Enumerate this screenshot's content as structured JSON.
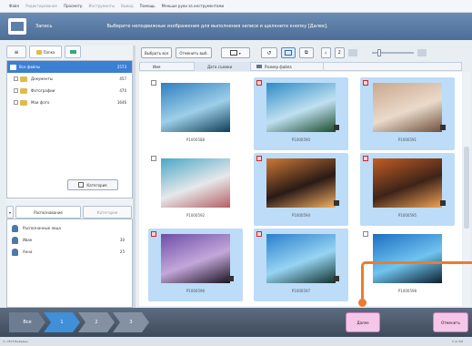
{
  "menu": [
    {
      "label": "Файл",
      "dim": false
    },
    {
      "label": "Редактирование",
      "dim": true
    },
    {
      "label": "Просмотр",
      "dim": false
    },
    {
      "label": "Инструменты",
      "dim": true
    },
    {
      "label": "Вывод",
      "dim": true
    },
    {
      "label": "Помощь",
      "dim": false
    },
    {
      "label": "Меньше руки за инструментами",
      "dim": false
    }
  ],
  "header": {
    "title": "Запись",
    "instruction": "Выберите неподвижные изображения для выполнения записи и щелкните кнопку [Далее]."
  },
  "left_tabs": [
    "Папка"
  ],
  "tree": [
    {
      "label": "Все файлы",
      "count": "2573",
      "expand": false,
      "selected": true
    },
    {
      "label": "Документы",
      "count": "457",
      "expand": true,
      "selected": false
    },
    {
      "label": "Фотографии",
      "count": "470",
      "expand": true,
      "selected": false
    },
    {
      "label": "Мои фото",
      "count": "1646",
      "expand": true,
      "selected": false
    }
  ],
  "lower_tabs": [
    "Распознавание",
    "Категория"
  ],
  "people_list": [
    {
      "label": "Распознанные лица",
      "count": ""
    },
    {
      "label": "Иван",
      "count": "30"
    },
    {
      "label": "Анна",
      "count": "25"
    }
  ],
  "category_button": "Категория",
  "toolbar": {
    "select_all": "Выбрать все",
    "deselect": "Отменить выб."
  },
  "sort_columns": [
    "Имя",
    "Дата съемки",
    "Размер файла"
  ],
  "thumbnails": [
    {
      "name": "P1000588",
      "selected": false,
      "flag": false,
      "palette": [
        "#2f7fbf",
        "#9ecfe8",
        "#0e3d58"
      ]
    },
    {
      "name": "P1000590",
      "selected": true,
      "flag": true,
      "palette": [
        "#2e8bc6",
        "#bfe0f0",
        "#1b4c2b"
      ]
    },
    {
      "name": "P1000591",
      "selected": true,
      "flag": true,
      "palette": [
        "#c9a88c",
        "#eadacb",
        "#6d4f3a"
      ]
    },
    {
      "name": "P1000592",
      "selected": false,
      "flag": false,
      "palette": [
        "#4aa7c6",
        "#e6e8ea",
        "#b45f65"
      ]
    },
    {
      "name": "P1000594",
      "selected": true,
      "flag": true,
      "palette": [
        "#cc7a35",
        "#2a1a16",
        "#f3b066"
      ]
    },
    {
      "name": "P1000595",
      "selected": true,
      "flag": true,
      "palette": [
        "#c35d23",
        "#3d2418",
        "#f1a258"
      ]
    },
    {
      "name": "P1000596",
      "selected": true,
      "flag": true,
      "palette": [
        "#6e4ea7",
        "#c3a7da",
        "#1a1320"
      ]
    },
    {
      "name": "P1000597",
      "selected": true,
      "flag": true,
      "palette": [
        "#297fcc",
        "#97d4f2",
        "#10312c"
      ]
    },
    {
      "name": "P1000598",
      "selected": false,
      "flag": false,
      "palette": [
        "#1d6fc2",
        "#6fc4ef",
        "#0b1f2c"
      ]
    }
  ],
  "steps": [
    "Все",
    "1",
    "2",
    "3"
  ],
  "buttons": {
    "next": "Далее",
    "cancel": "Отменить"
  },
  "status": {
    "left": "3 / 2573 Выбраны",
    "right": "3 из 3/8"
  },
  "colors": {
    "accent": "#ec7b30",
    "selection": "#3d7fd1",
    "thumb_sel": "#bcdcf8",
    "button_pink": "#f5c6e8"
  }
}
